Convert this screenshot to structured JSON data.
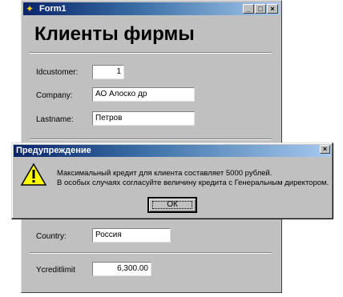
{
  "window": {
    "title": "Form1",
    "minimize": "_",
    "maximize": "□",
    "close": "×"
  },
  "form": {
    "heading": "Клиенты фирмы",
    "fields": {
      "idcustomer": {
        "label": "Idcustomer:",
        "value": "1"
      },
      "company": {
        "label": "Company:",
        "value": "АО Алоско др"
      },
      "lastname": {
        "label": "Lastname:",
        "value": "Петров"
      },
      "country": {
        "label": "Country:",
        "value": "Россия"
      },
      "ycreditlimit": {
        "label": "Ycreditlimit",
        "value": "6,300.00"
      }
    }
  },
  "dialog": {
    "title": "Предупреждение",
    "close": "×",
    "message_line1": "Максимальный кредит для клиента составляет 5000 рублей.",
    "message_line2": "В особых случаях согласуйте величину кредита с Генеральным директором.",
    "ok_label": "ОК"
  }
}
